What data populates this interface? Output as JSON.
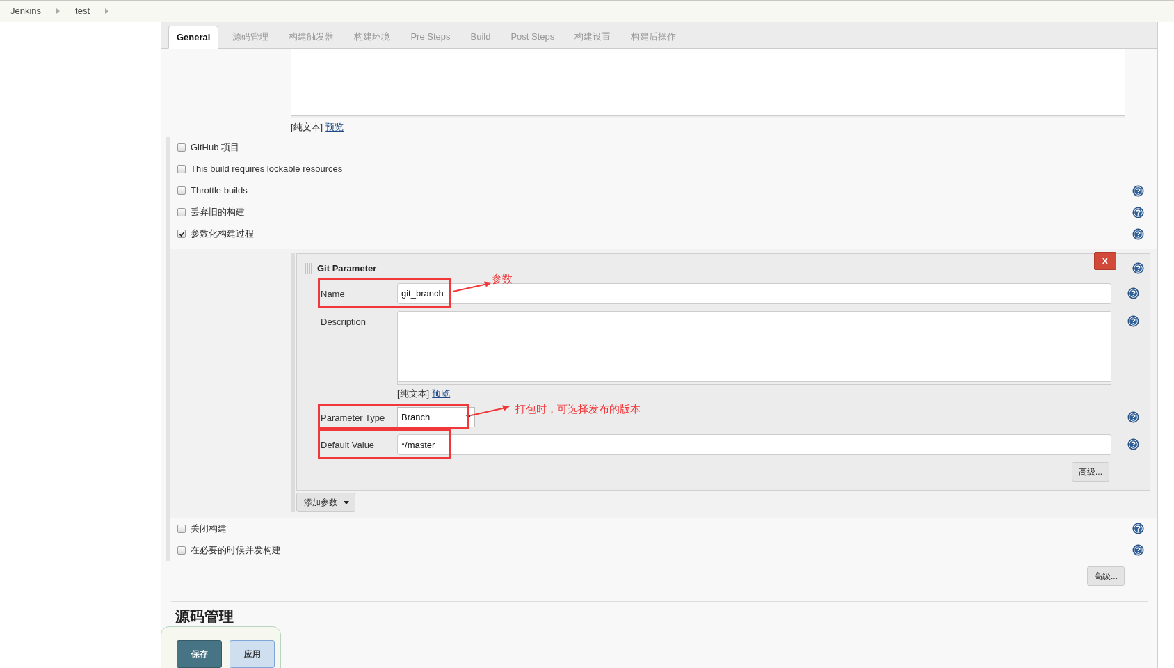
{
  "breadcrumbs": [
    {
      "label": "Jenkins"
    },
    {
      "label": "test"
    }
  ],
  "tabs": [
    {
      "label": "General",
      "selected": true
    },
    {
      "label": "源码管理",
      "selected": false
    },
    {
      "label": "构建触发器",
      "selected": false
    },
    {
      "label": "构建环境",
      "selected": false
    },
    {
      "label": "Pre Steps",
      "selected": false
    },
    {
      "label": "Build",
      "selected": false
    },
    {
      "label": "Post Steps",
      "selected": false
    },
    {
      "label": "构建设置",
      "selected": false
    },
    {
      "label": "构建后操作",
      "selected": false
    }
  ],
  "description": {
    "format_label": "[纯文本]",
    "preview_link": "预览"
  },
  "options": [
    {
      "label": "GitHub 项目",
      "checked": false,
      "help": false
    },
    {
      "label": "This build requires lockable resources",
      "checked": false,
      "help": false
    },
    {
      "label": "Throttle builds",
      "checked": false,
      "help": true
    },
    {
      "label": "丢弃旧的构建",
      "checked": false,
      "help": true
    },
    {
      "label": "参数化构建过程",
      "checked": true,
      "help": true
    }
  ],
  "git_parameter": {
    "title": "Git Parameter",
    "remove_button": "x",
    "fields": [
      {
        "kind": "text",
        "label": "Name",
        "value": "git_branch",
        "highlighted": true,
        "annotation": "参数"
      },
      {
        "kind": "textarea",
        "label": "Description",
        "highlighted": false,
        "format_label": "[纯文本]",
        "preview_link": "预览"
      },
      {
        "kind": "select",
        "label": "Parameter Type",
        "value": "Branch",
        "highlighted": true,
        "annotation": "打包时，可选择发布的版本"
      },
      {
        "kind": "text",
        "label": "Default Value",
        "value": "*/master",
        "highlighted": true
      }
    ],
    "advanced_button": "高级..."
  },
  "add_parameter_button": "添加参数",
  "options_after": [
    {
      "label": "关闭构建",
      "checked": false,
      "help": true
    },
    {
      "label": "在必要的时候并发构建",
      "checked": false,
      "help": true
    }
  ],
  "advanced_button": "高级...",
  "section_heading": "源码管理",
  "footer_buttons": [
    {
      "label": "保存",
      "kind": "primary"
    },
    {
      "label": "应用",
      "kind": "secondary"
    }
  ]
}
